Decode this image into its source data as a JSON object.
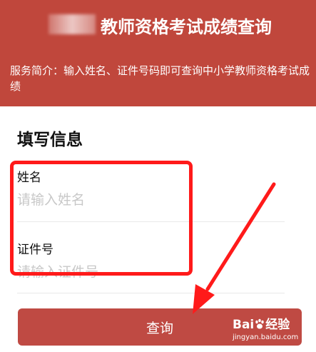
{
  "header": {
    "title": "教师资格考试成绩查询",
    "intro": "服务简介：输入姓名、证件号码即可查询中小学教师资格考试成绩"
  },
  "form": {
    "section_title": "填写信息",
    "name_label": "姓名",
    "name_placeholder": "请输入姓名",
    "id_label": "证件号",
    "id_placeholder": "请输入证件号"
  },
  "submit": {
    "label": "查询"
  },
  "watermark": {
    "brand_left": "Bai",
    "brand_right": "经验",
    "url": "jingyan.baidu.com"
  },
  "colors": {
    "header_bg": "#c0473c",
    "button_bg": "#bf4a43",
    "annotation_red": "#ff1a1a"
  }
}
